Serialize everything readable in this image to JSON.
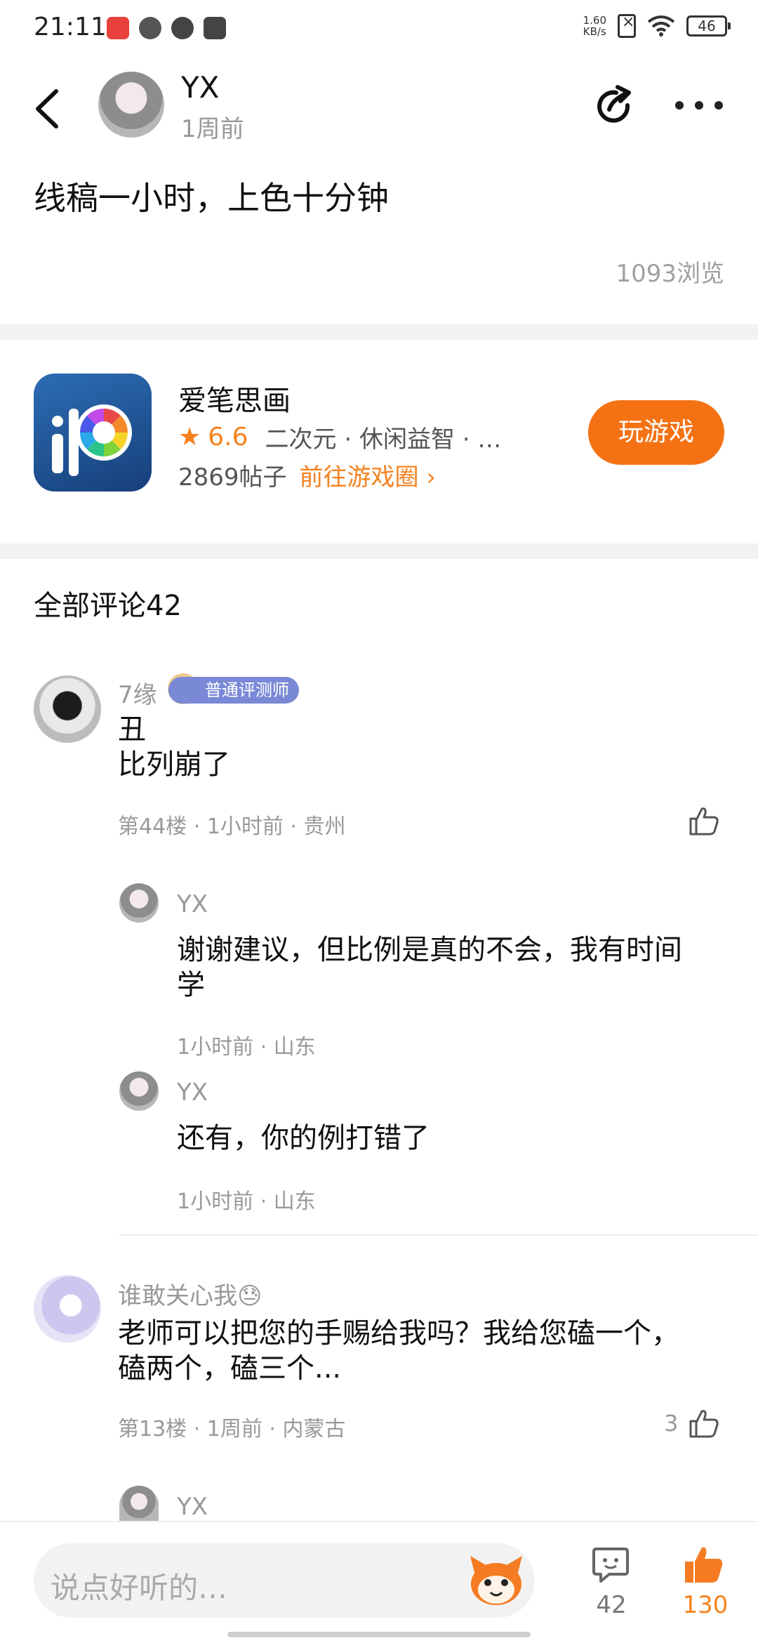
{
  "status_bar": {
    "time": "21:11",
    "net_speed_value": "1.60",
    "net_speed_unit": "KB/s",
    "battery": "46",
    "app_icons": [
      "app-icon-red",
      "app-icon-link",
      "app-icon-play",
      "app-icon-book"
    ]
  },
  "header": {
    "username": "YX",
    "post_time": "1周前"
  },
  "post": {
    "text": "线稿一小时，上色十分钟",
    "views": "1093浏览"
  },
  "game_card": {
    "name": "爱笔思画",
    "rating": "6.6",
    "tags": "二次元 · 休闲益智 · …",
    "posts": "2869帖子",
    "goto_circle": "前往游戏圈",
    "play_label": "玩游戏"
  },
  "comments_section": {
    "title": "全部评论42"
  },
  "comments": [
    {
      "name": "7缘",
      "badge": "普通评测师",
      "line1": "丑",
      "line2": "比列崩了",
      "meta": "第44楼 · 1小时前 · 贵州",
      "likes": "",
      "replies": [
        {
          "name": "YX",
          "line1": "谢谢建议，但比例是真的不会，我有时间",
          "line2": "学",
          "meta": "1小时前 · 山东"
        },
        {
          "name": "YX",
          "line1": "还有，你的例打错了",
          "meta": "1小时前 · 山东"
        }
      ]
    },
    {
      "name": "谁敢关心我😓",
      "line1": "老师可以把您的手赐给我吗？我给您磕一个，",
      "line2": "磕两个，磕三个...",
      "meta": "第13楼 · 1周前 · 内蒙古",
      "likes": "3",
      "replies": [
        {
          "name": "YX"
        }
      ]
    }
  ],
  "bottom_bar": {
    "input_placeholder": "说点好听的…",
    "comment_count": "42",
    "like_count": "130"
  },
  "colors": {
    "accent": "#f57214",
    "badge": "#7a89d6"
  }
}
